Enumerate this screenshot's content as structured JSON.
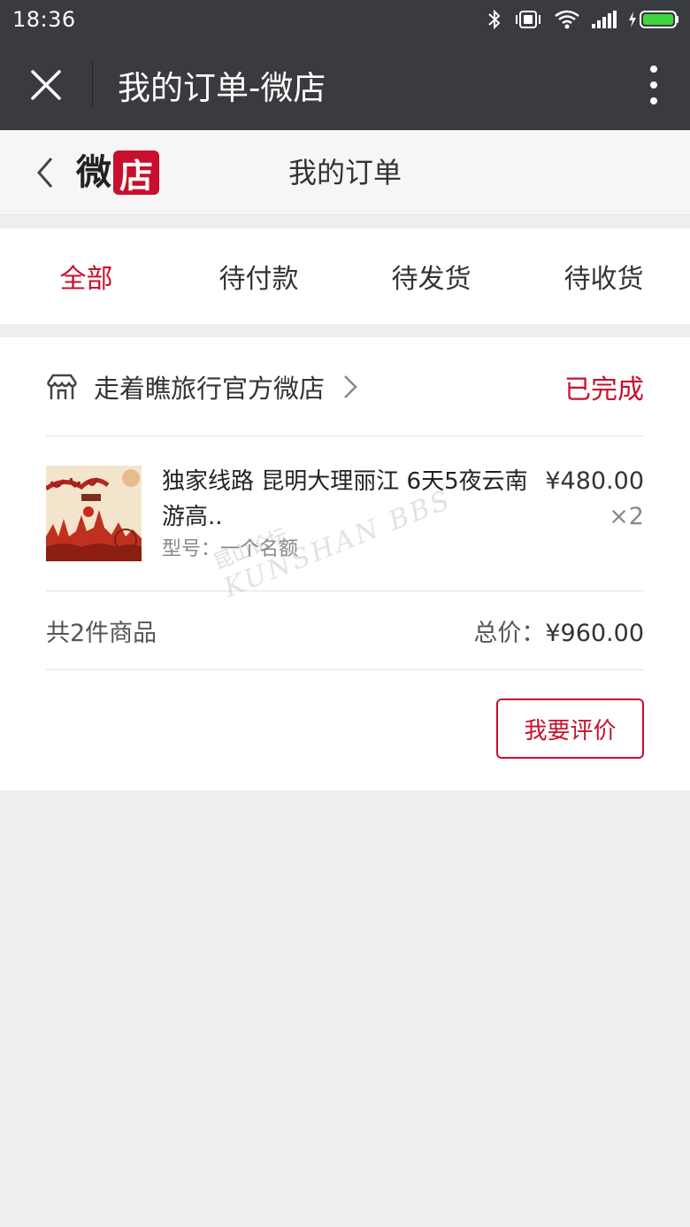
{
  "status_bar": {
    "time": "18:36"
  },
  "title_bar": {
    "title": "我的订单-微店"
  },
  "shop_header": {
    "logo_text_1": "微",
    "logo_text_2": "店",
    "page_title": "我的订单"
  },
  "tabs": [
    {
      "label": "全部",
      "active": true
    },
    {
      "label": "待付款",
      "active": false
    },
    {
      "label": "待发货",
      "active": false
    },
    {
      "label": "待收货",
      "active": false
    }
  ],
  "order": {
    "shop_name": "走着瞧旅行官方微店",
    "status": "已完成",
    "product": {
      "name": "独家线路 昆明大理丽江 6天5夜云南游高..",
      "spec": "型号：一个名额",
      "price": "¥480.00",
      "quantity": "×2",
      "thumbnail": "product-thumbnail-image"
    },
    "item_count": "共2件商品",
    "total_label": "总价：",
    "total_value": "¥960.00",
    "review_button": "我要评价"
  },
  "watermark": {
    "cn": "昆山论坛",
    "en": "KUNSHAN BBS"
  },
  "colors": {
    "accent": "#c8102e",
    "dark_bar": "#3a3b3f",
    "background": "#eeeeee"
  }
}
